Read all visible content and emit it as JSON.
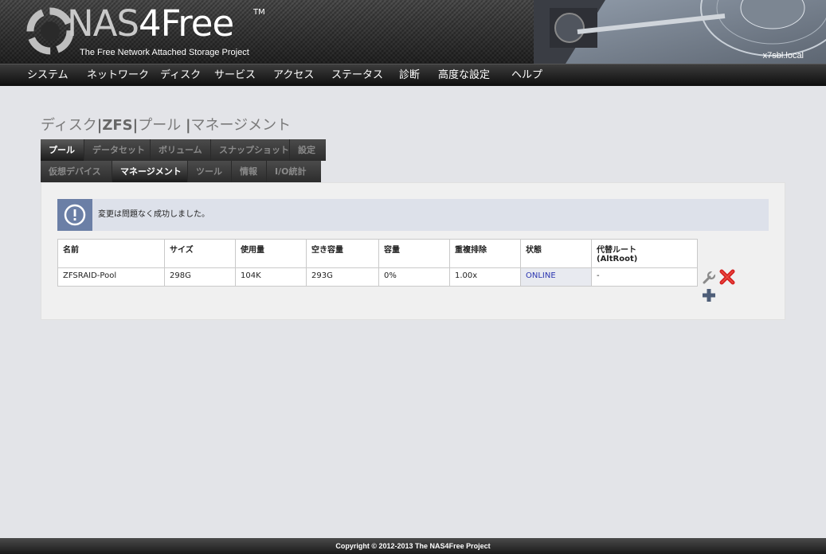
{
  "header": {
    "logo_nas": "NAS",
    "logo_4free": "4Free",
    "logo_tm": "TM",
    "tagline": "The Free Network Attached Storage Project",
    "hostname": "x7sbl.local"
  },
  "menu": [
    "システム",
    "ネットワーク",
    "ディスク",
    "サービス",
    "アクセス",
    "ステータス",
    "診断",
    "高度な設定",
    "ヘルプ"
  ],
  "page_title": {
    "part1": "ディスク",
    "sep": "|",
    "part2": "ZFS",
    "part3": "プール",
    "part4": "マネージメント"
  },
  "tabs_primary": [
    {
      "label": "プール",
      "active": true
    },
    {
      "label": "データセット",
      "active": false
    },
    {
      "label": "ボリューム",
      "active": false
    },
    {
      "label": "スナップショット",
      "active": false
    },
    {
      "label": "設定",
      "active": false
    }
  ],
  "tabs_secondary": [
    {
      "label": "仮想デバイス",
      "active": false
    },
    {
      "label": "マネージメント",
      "active": true
    },
    {
      "label": "ツール",
      "active": false
    },
    {
      "label": "情報",
      "active": false
    },
    {
      "label": "I/O統計",
      "active": false
    }
  ],
  "info_message": "変更は問題なく成功しました。",
  "table": {
    "headers": [
      "名前",
      "サイズ",
      "使用量",
      "空き容量",
      "容量",
      "重複排除",
      "状態",
      "代替ルート",
      "(AltRoot)"
    ],
    "rows": [
      [
        "ZFSRAID-Pool",
        "298G",
        "104K",
        "293G",
        "0%",
        "1.00x",
        "ONLINE",
        "-"
      ]
    ]
  },
  "footer": "Copyright © 2012-2013 The NAS4Free Project",
  "colors": {
    "info_icon_bg": "#6b7fa6",
    "status_online": "#2b35b0",
    "delete_red": "#d42020"
  },
  "icons": [
    "logo-ring-icon",
    "hdd-icon",
    "info-icon",
    "wrench-icon",
    "delete-icon",
    "add-icon"
  ]
}
